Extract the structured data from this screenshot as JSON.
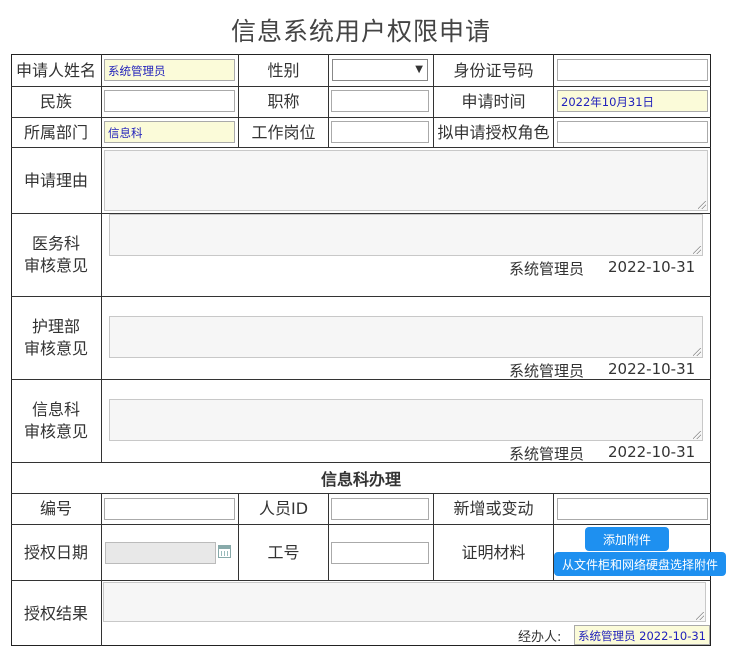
{
  "title": "信息系统用户权限申请",
  "applicant": {
    "name_label": "申请人姓名",
    "name_value": "系统管理员",
    "gender_label": "性别",
    "gender_value": "",
    "id_label": "身份证号码",
    "id_value": "",
    "ethnic_label": "民族",
    "ethnic_value": "",
    "title_label": "职称",
    "title_value": "",
    "apply_time_label": "申请时间",
    "apply_time_value": "2022年10月31日",
    "dept_label": "所属部门",
    "dept_value": "信息科",
    "post_label": "工作岗位",
    "post_value": "",
    "role_label": "拟申请授权角色",
    "role_value": "",
    "reason_label": "申请理由",
    "reason_value": ""
  },
  "reviews": [
    {
      "label_l1": "医务科",
      "label_l2": "审核意见",
      "signer": "系统管理员",
      "date": "2022-10-31"
    },
    {
      "label_l1": "护理部",
      "label_l2": "审核意见",
      "signer": "系统管理员",
      "date": "2022-10-31"
    },
    {
      "label_l1": "信息科",
      "label_l2": "审核意见",
      "signer": "系统管理员",
      "date": "2022-10-31"
    }
  ],
  "info_section": {
    "heading": "信息科办理",
    "number_label": "编号",
    "number_value": "",
    "person_id_label": "人员ID",
    "person_id_value": "",
    "change_label": "新增或变动",
    "change_value": "",
    "auth_date_label": "授权日期",
    "auth_date_value": "",
    "job_no_label": "工号",
    "job_no_value": "",
    "proof_label": "证明材料",
    "add_attachment_btn": "添加附件",
    "choose_attachment_btn": "从文件柜和网络硬盘选择附件",
    "result_label": "授权结果",
    "handler_label": "经办人:",
    "handler_value": "系统管理员 2022-10-31"
  },
  "icons": {
    "calendar": "calendar-icon",
    "dropdown": "chevron-down-icon"
  }
}
